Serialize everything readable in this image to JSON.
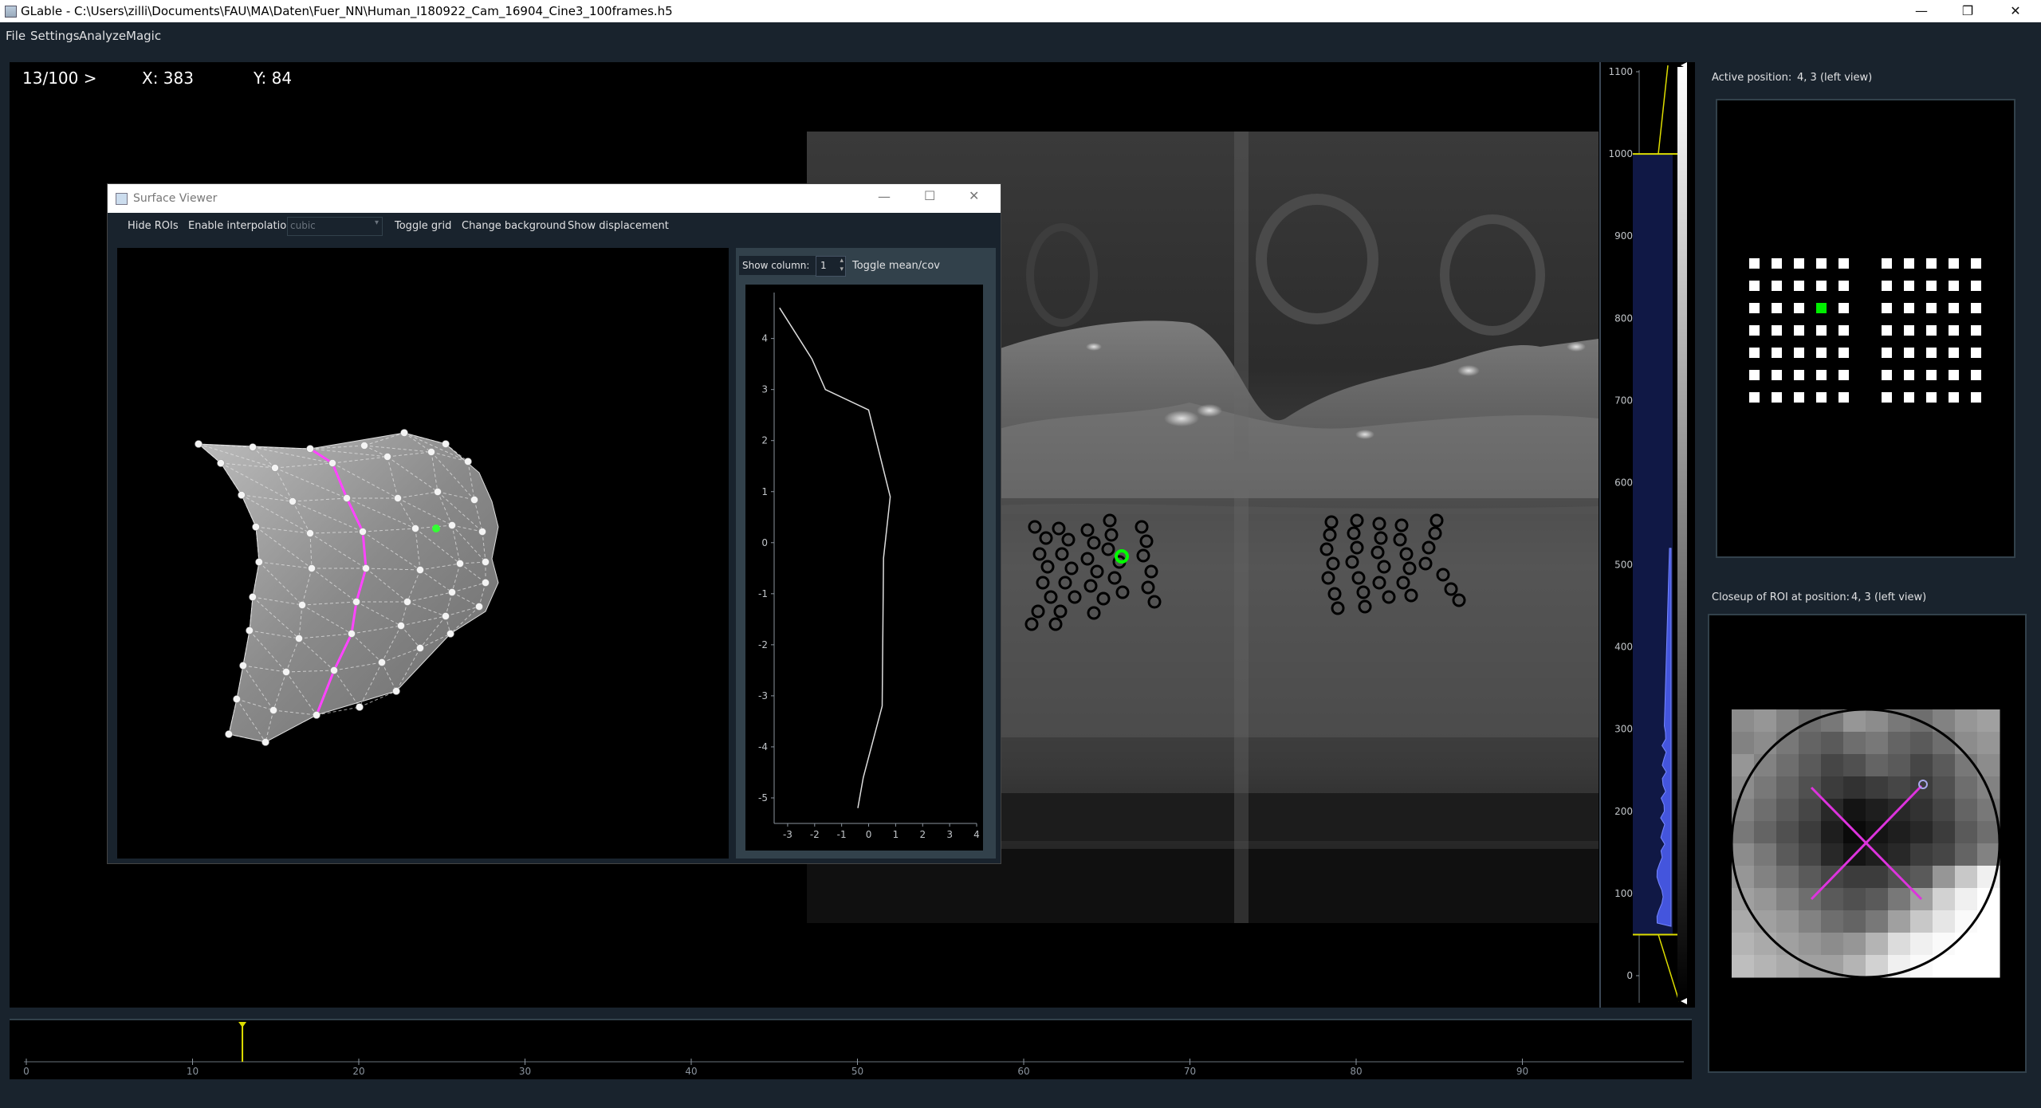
{
  "window": {
    "title": "GLable - C:\\Users\\zilli\\Documents\\FAU\\MA\\Daten\\Fuer_NN\\Human_I180922_Cam_16904_Cine3_100frames.h5",
    "minimize": "—",
    "maximize": "❐",
    "close": "✕"
  },
  "menu": [
    "File",
    "Settings",
    "Analyze",
    "Magic"
  ],
  "readout": {
    "frame": "13/100 >",
    "x": "X: 383",
    "y": "Y: 84"
  },
  "histogram": {
    "ticks": [
      "1100",
      "1000",
      "900",
      "800",
      "700",
      "600",
      "500",
      "400",
      "300",
      "200",
      "100",
      "0"
    ],
    "level_high": 1000,
    "level_low": 50
  },
  "timeline": {
    "ticks": [
      "0",
      "10",
      "20",
      "30",
      "40",
      "50",
      "60",
      "70",
      "80",
      "90"
    ],
    "current_frame": 13
  },
  "right_panel": {
    "active_label": "Active position:",
    "active_value": "4, 3 (left view)",
    "closeup_label": "Closeup of ROI at position:",
    "closeup_value": "4, 3 (left view)",
    "active_cell": {
      "row": 3,
      "col": 4
    },
    "grid_rows": 7,
    "grid_cols_left": 5,
    "grid_cols_right": 5
  },
  "surface_viewer": {
    "title": "Surface Viewer",
    "toolbar": {
      "hide_rois": "Hide ROIs",
      "enable_interpolation": "Enable interpolation",
      "interp_value": "cubic",
      "toggle_grid": "Toggle grid",
      "change_background": "Change background",
      "show_displacement": "Show displacement"
    },
    "side": {
      "show_column_label": "Show column:",
      "column_value": "1",
      "toggle_mean": "Toggle mean/cov"
    },
    "profile_plot": {
      "x_ticks": [
        "-3",
        "-2",
        "-1",
        "0",
        "1",
        "2",
        "3",
        "4"
      ],
      "y_ticks": [
        "4",
        "3",
        "2",
        "1",
        "0",
        "-1",
        "-2",
        "-3",
        "-4",
        "-5"
      ]
    }
  },
  "chart_data": {
    "type": "line",
    "x": [
      -3.3,
      -2.7,
      -2.1,
      -1.6,
      0.0,
      0.8,
      0.55,
      0.5,
      -0.2,
      -0.4
    ],
    "y": [
      4.6,
      4.1,
      3.6,
      3.0,
      2.6,
      0.9,
      -0.3,
      -3.2,
      -4.6,
      -5.2
    ],
    "xlim": [
      -3.5,
      4
    ],
    "ylim": [
      -5.5,
      4.9
    ]
  },
  "colors": {
    "background": "#19232d",
    "roi_active": "#00ff00",
    "profile_line": "#ff44ff",
    "histogram_fill": "#3344bb",
    "marker": "#dddd00"
  }
}
